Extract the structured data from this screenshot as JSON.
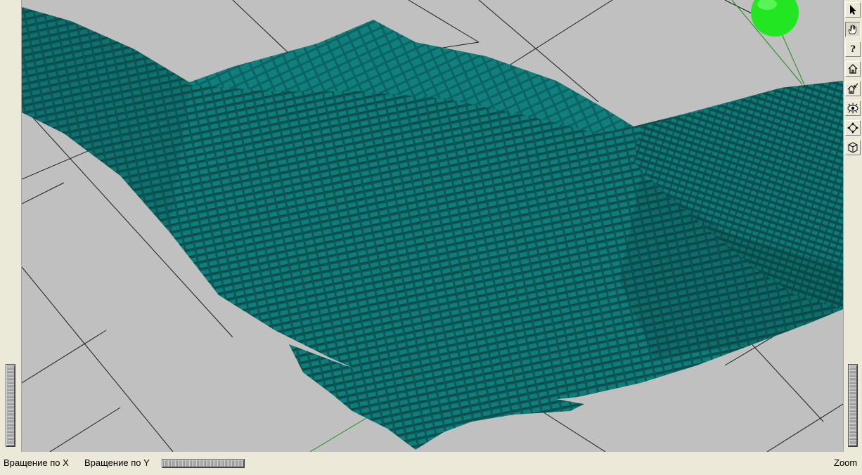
{
  "toolbar": {
    "buttons": [
      {
        "name": "select-arrow-icon"
      },
      {
        "name": "hand-pan-icon",
        "pressed": true
      },
      {
        "name": "question-help-icon",
        "glyph": "?"
      },
      {
        "name": "home-icon"
      },
      {
        "name": "set-home-icon"
      },
      {
        "name": "view-all-eye-icon"
      },
      {
        "name": "seek-crosshair-icon"
      },
      {
        "name": "projection-cube-icon"
      }
    ]
  },
  "status": {
    "rotate_x_label": "Вращение по X",
    "rotate_y_label": "Вращение по Y",
    "zoom_label": "Zoom"
  },
  "scene": {
    "background": "#c0c0c0",
    "surface_color": "#0e7a78",
    "surface_shadow": "#0a4a48",
    "grid_color": "#202020",
    "axis_color": "#1a7a1a",
    "light_sphere_color": "#22e622"
  }
}
